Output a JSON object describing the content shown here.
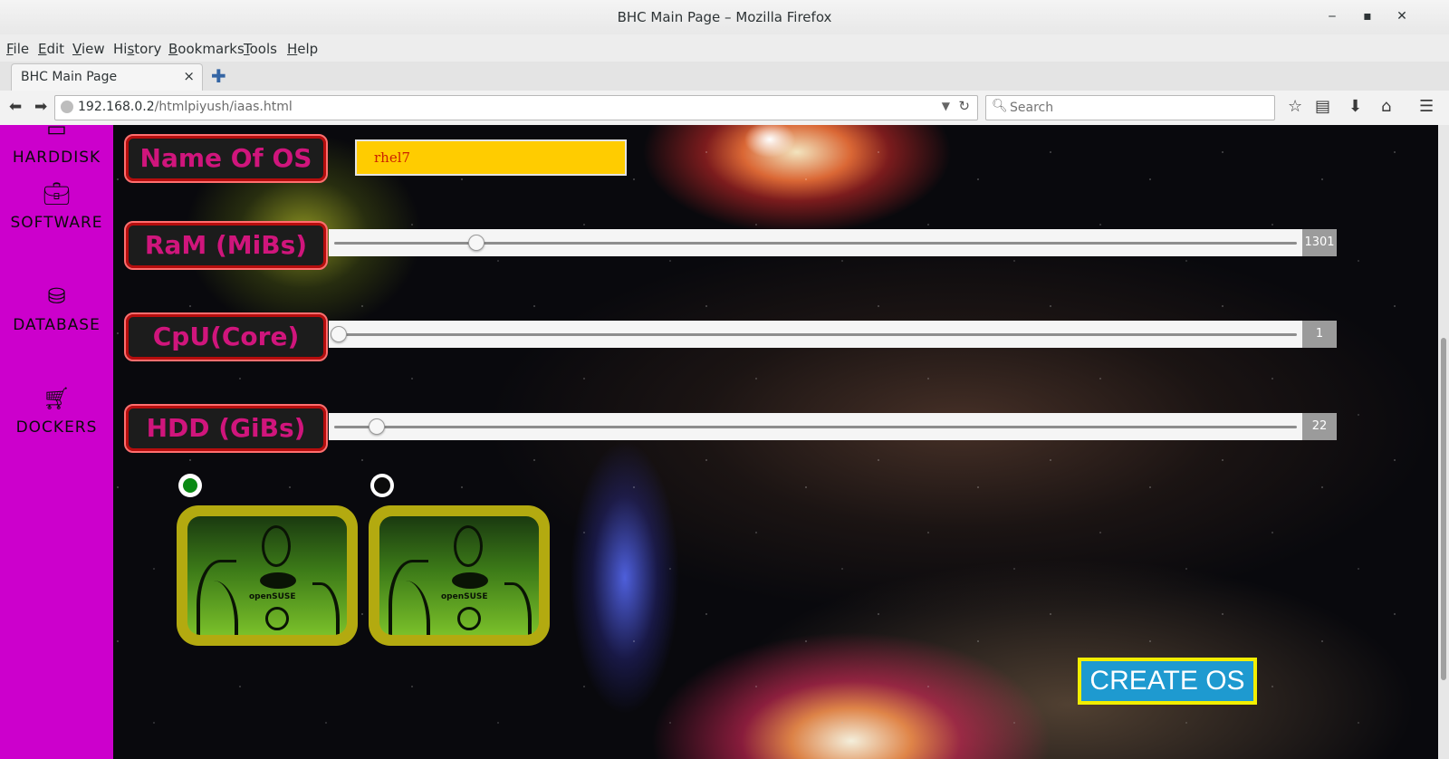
{
  "window": {
    "title": "BHC Main Page – Mozilla Firefox",
    "minimize": "‒",
    "maximize": "▪",
    "close": "✕"
  },
  "menu": {
    "file": {
      "pre": "",
      "key": "F",
      "post": "ile"
    },
    "edit": {
      "pre": "",
      "key": "E",
      "post": "dit"
    },
    "view": {
      "pre": "",
      "key": "V",
      "post": "iew"
    },
    "history": {
      "pre": "Hi",
      "key": "s",
      "post": "tory"
    },
    "bookmarks": {
      "pre": "",
      "key": "B",
      "post": "ookmarks"
    },
    "tools": {
      "pre": "",
      "key": "T",
      "post": "ools"
    },
    "help": {
      "pre": "",
      "key": "H",
      "post": "elp"
    }
  },
  "tab": {
    "label": "BHC Main Page",
    "close": "×",
    "new": "✚"
  },
  "nav": {
    "url_host": "192.168.0.2",
    "url_path": "/htmlpiyush/iaas.html",
    "search_placeholder": "Search"
  },
  "sidebar": {
    "items": [
      {
        "label": "HARDDISK",
        "icon": "harddisk-icon"
      },
      {
        "label": "SOFTWARE",
        "icon": "briefcase-icon"
      },
      {
        "label": "DATABASE",
        "icon": "database-icon"
      },
      {
        "label": "DOCKERS",
        "icon": "cart-icon"
      }
    ]
  },
  "form": {
    "name_label": "Name Of OS",
    "name_value": "rhel7",
    "ram": {
      "label": "RaM (MiBs)",
      "value": "1301",
      "fraction": 0.145
    },
    "cpu": {
      "label": "CpU(Core)",
      "value": "1",
      "fraction": 0.0
    },
    "hdd": {
      "label": "HDD (GiBs)",
      "value": "22",
      "fraction": 0.04
    },
    "os_options": [
      {
        "brand": "openSUSE",
        "selected": true
      },
      {
        "brand": "openSUSE",
        "selected": false
      }
    ],
    "create_label": "CREATE OS"
  },
  "colors": {
    "sidebar": "#cc00cc",
    "label_text": "#d0157c",
    "input_bg": "#ffcc00",
    "create_bg": "#1e9ad0",
    "create_border": "#f2ee00",
    "radio_selected": "#0a8a14"
  }
}
